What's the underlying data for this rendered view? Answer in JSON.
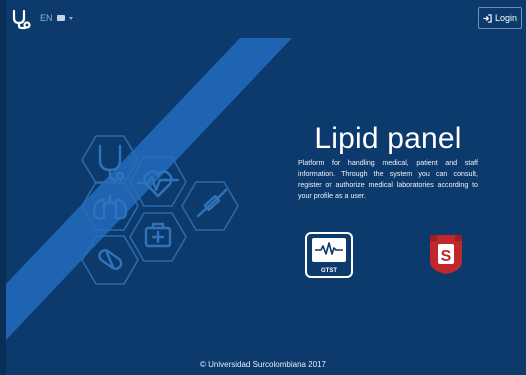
{
  "navbar": {
    "logo_icon": "stethoscope-icon",
    "language": {
      "code": "EN",
      "icon": "flag-icon",
      "caret_icon": "caret-down-icon"
    },
    "login": {
      "label": "Login",
      "icon": "sign-in-icon"
    }
  },
  "hero": {
    "title": "Lipid panel",
    "description": "Platform for handling medical, patient and staff information. Through the system you can consult, register or authorize medical laboratories according to your profile as a user."
  },
  "logos": {
    "gtst": {
      "text": "GTST"
    },
    "usco": {
      "text": "S"
    }
  },
  "decoration_icons": [
    "stethoscope-icon",
    "heartbeat-icon",
    "lungs-icon",
    "syringe-icon",
    "first-aid-kit-icon",
    "pill-icon"
  ],
  "footer": {
    "text": "© Universidad Surcolombiana 2017"
  },
  "colors": {
    "background": "#0c3a6c",
    "stripe": "#1f63b3",
    "usco_red": "#c0282e"
  }
}
